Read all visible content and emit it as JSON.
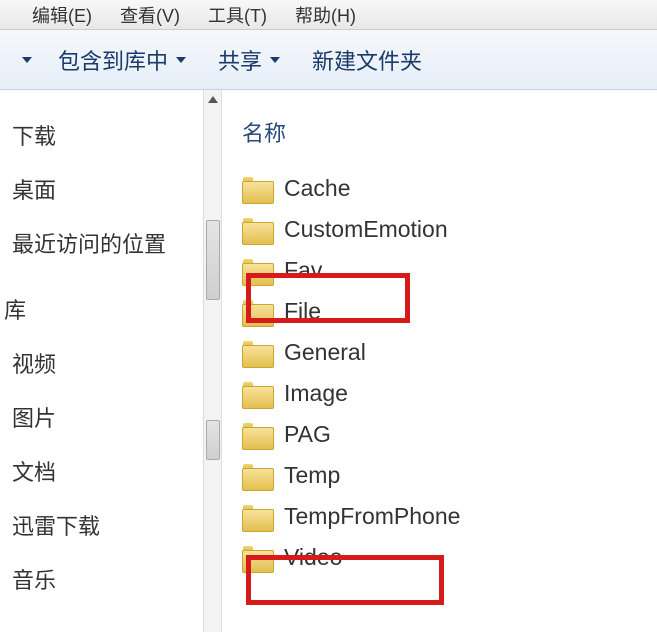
{
  "menu": {
    "edit": "编辑(E)",
    "view": "查看(V)",
    "tools": "工具(T)",
    "help": "帮助(H)"
  },
  "toolbar": {
    "include_in_library": "包含到库中",
    "share": "共享",
    "new_folder": "新建文件夹"
  },
  "sidebar": {
    "items_top": [
      {
        "label": "下载"
      },
      {
        "label": "桌面"
      },
      {
        "label": "最近访问的位置"
      }
    ],
    "group_label": "库",
    "items_lib": [
      {
        "label": "视频"
      },
      {
        "label": "图片"
      },
      {
        "label": "文档"
      },
      {
        "label": "迅雷下载"
      },
      {
        "label": "音乐"
      }
    ]
  },
  "content": {
    "column_header": "名称",
    "folders": [
      {
        "name": "Cache"
      },
      {
        "name": "CustomEmotion"
      },
      {
        "name": "Fav"
      },
      {
        "name": "File"
      },
      {
        "name": "General"
      },
      {
        "name": "Image"
      },
      {
        "name": "PAG"
      },
      {
        "name": "Temp"
      },
      {
        "name": "TempFromPhone"
      },
      {
        "name": "Video"
      }
    ]
  }
}
